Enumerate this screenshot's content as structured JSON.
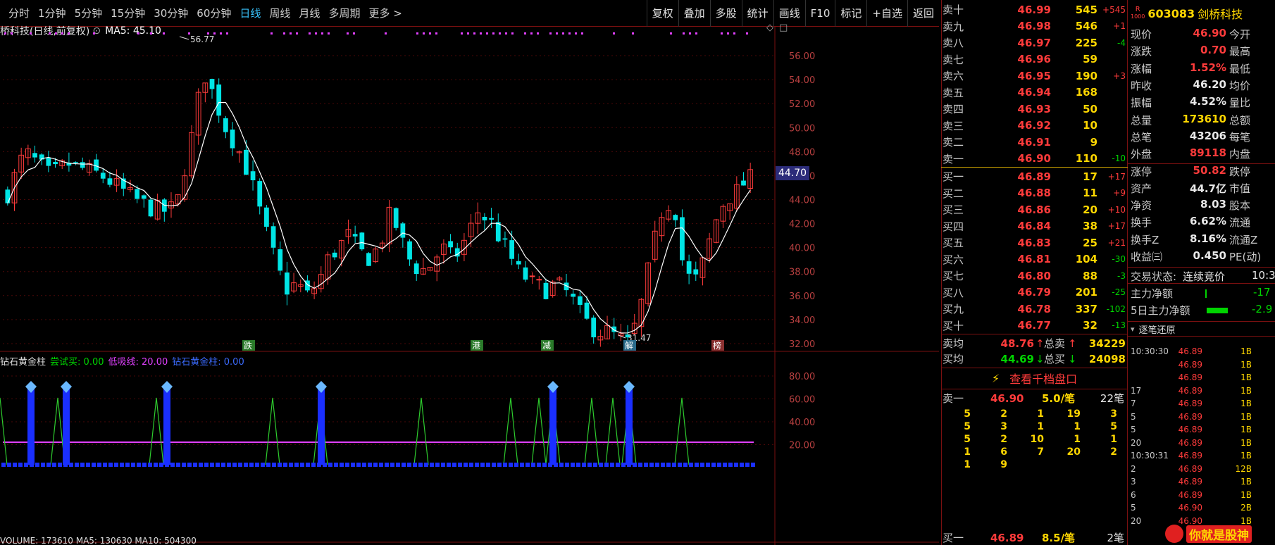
{
  "toolbar": {
    "periods": [
      "分时",
      "1分钟",
      "5分钟",
      "15分钟",
      "30分钟",
      "60分钟",
      "日线",
      "周线",
      "月线",
      "多周期",
      "更多 >"
    ],
    "active": "日线",
    "buttons": [
      "复权",
      "叠加",
      "多股",
      "统计",
      "画线",
      "F10",
      "标记",
      "+自选",
      "返回"
    ]
  },
  "chart": {
    "title": "桥科技(日线,前复权)",
    "ma_label": "MA5: 45.10",
    "high_label": "56.77",
    "low_label": "31.47",
    "price_tag": "44.70",
    "y_labels": [
      "56.00",
      "54.00",
      "52.00",
      "50.00",
      "48.00",
      "46.00",
      "44.00",
      "42.00",
      "40.00",
      "38.00",
      "36.00",
      "34.00",
      "32.00"
    ],
    "event_labels": [
      "跌",
      "港",
      "减",
      "解",
      "榜"
    ]
  },
  "indicator": {
    "name": "钻石黄金柱",
    "params": [
      {
        "label": "尝试买:",
        "value": "0.00",
        "color": "#00d400"
      },
      {
        "label": "低吸线:",
        "value": "20.00",
        "color": "#e040ff"
      },
      {
        "label": "钻石黄金柱:",
        "value": "0.00",
        "color": "#3b6bff"
      }
    ],
    "y_labels": [
      "80.00",
      "60.00",
      "40.00",
      "20.00"
    ],
    "bottom_line": "VOLUME: 173610 MA5: 130630 MA10: 504300"
  },
  "order_book": {
    "sells": [
      {
        "label": "卖十",
        "price": "46.99",
        "vol": "545",
        "chg": "+545"
      },
      {
        "label": "卖九",
        "price": "46.98",
        "vol": "546",
        "chg": "+1"
      },
      {
        "label": "卖八",
        "price": "46.97",
        "vol": "225",
        "chg": "-4"
      },
      {
        "label": "卖七",
        "price": "46.96",
        "vol": "59",
        "chg": ""
      },
      {
        "label": "卖六",
        "price": "46.95",
        "vol": "190",
        "chg": "+3"
      },
      {
        "label": "卖五",
        "price": "46.94",
        "vol": "168",
        "chg": ""
      },
      {
        "label": "卖四",
        "price": "46.93",
        "vol": "50",
        "chg": ""
      },
      {
        "label": "卖三",
        "price": "46.92",
        "vol": "10",
        "chg": ""
      },
      {
        "label": "卖二",
        "price": "46.91",
        "vol": "9",
        "chg": ""
      },
      {
        "label": "卖一",
        "price": "46.90",
        "vol": "110",
        "chg": "-10"
      }
    ],
    "buys": [
      {
        "label": "买一",
        "price": "46.89",
        "vol": "17",
        "chg": "+17"
      },
      {
        "label": "买二",
        "price": "46.88",
        "vol": "11",
        "chg": "+9"
      },
      {
        "label": "买三",
        "price": "46.86",
        "vol": "20",
        "chg": "+10"
      },
      {
        "label": "买四",
        "price": "46.84",
        "vol": "38",
        "chg": "+17"
      },
      {
        "label": "买五",
        "price": "46.83",
        "vol": "25",
        "chg": "+21"
      },
      {
        "label": "买六",
        "price": "46.81",
        "vol": "104",
        "chg": "-30"
      },
      {
        "label": "买七",
        "price": "46.80",
        "vol": "88",
        "chg": "-3"
      },
      {
        "label": "买八",
        "price": "46.79",
        "vol": "201",
        "chg": "-25"
      },
      {
        "label": "买九",
        "price": "46.78",
        "vol": "337",
        "chg": "-102"
      },
      {
        "label": "买十",
        "price": "46.77",
        "vol": "32",
        "chg": "-13"
      }
    ],
    "avg": [
      {
        "label": "卖均",
        "price": "48.76",
        "tlabel": "总卖",
        "total": "34229"
      },
      {
        "label": "买均",
        "price": "44.69",
        "tlabel": "总买",
        "total": "24098"
      }
    ],
    "view_all": "查看千档盘口",
    "queue_head": {
      "label": "卖一",
      "price": "46.90",
      "vol": "5.0/笔",
      "count": "22笔"
    },
    "queue": [
      [
        "5",
        "2",
        "1",
        "19",
        "3"
      ],
      [
        "5",
        "3",
        "1",
        "1",
        "5"
      ],
      [
        "5",
        "2",
        "10",
        "1",
        "1"
      ],
      [
        "1",
        "6",
        "7",
        "20",
        "2"
      ],
      [
        "1",
        "9",
        "",
        "",
        ""
      ]
    ],
    "bottom": {
      "label": "买一",
      "price": "46.89",
      "vol": "8.5/笔",
      "count": "2笔"
    }
  },
  "stock": {
    "code": "603083",
    "name": "剑桥科技",
    "r_badge": "R",
    "r_sub": "1000",
    "rows": [
      {
        "l": "现价",
        "v": "46.90",
        "c": "red",
        "l2": "今开"
      },
      {
        "l": "涨跌",
        "v": "0.70",
        "c": "red",
        "l2": "最高"
      },
      {
        "l": "涨幅",
        "v": "1.52%",
        "c": "red",
        "l2": "最低"
      },
      {
        "l": "昨收",
        "v": "46.20",
        "c": "white",
        "l2": "均价"
      },
      {
        "l": "振幅",
        "v": "4.52%",
        "c": "white",
        "l2": "量比"
      },
      {
        "l": "总量",
        "v": "173610",
        "c": "yellow",
        "l2": "总额"
      },
      {
        "l": "总笔",
        "v": "43206",
        "c": "white",
        "l2": "每笔"
      },
      {
        "l": "外盘",
        "v": "89118",
        "c": "red",
        "l2": "内盘"
      },
      {
        "l": "涨停",
        "v": "50.82",
        "c": "red",
        "l2": "跌停"
      },
      {
        "l": "资产",
        "v": "44.7亿",
        "c": "white",
        "l2": "市值"
      },
      {
        "l": "净资",
        "v": "8.03",
        "c": "white",
        "l2": "股本"
      },
      {
        "l": "换手",
        "v": "6.62%",
        "c": "white",
        "l2": "流通"
      },
      {
        "l": "换手Z",
        "v": "8.16%",
        "c": "white",
        "l2": "流通Z"
      },
      {
        "l": "收益㈢",
        "v": "0.450",
        "c": "white",
        "l2": "PE(动)"
      }
    ],
    "trade_state_label": "交易状态:",
    "trade_state": "连续竞价",
    "trade_time": "10:3",
    "main_net_label": "主力净额",
    "main_net": "-17",
    "five_day_label": "5日主力净额",
    "five_day": "-2.9"
  },
  "tick_panel": {
    "title": "逐笔还原",
    "rows": [
      {
        "t": "10:30:30",
        "p": "46.89",
        "pc": "red",
        "v": "1B"
      },
      {
        "t": "",
        "p": "46.89",
        "pc": "red",
        "v": "1B"
      },
      {
        "t": "",
        "p": "46.89",
        "pc": "red",
        "v": "1B"
      },
      {
        "t": "17",
        "p": "46.89",
        "pc": "red",
        "v": "1B"
      },
      {
        "t": "7",
        "p": "46.89",
        "pc": "red",
        "v": "1B"
      },
      {
        "t": "5",
        "p": "46.89",
        "pc": "red",
        "v": "1B"
      },
      {
        "t": "5",
        "p": "46.89",
        "pc": "red",
        "v": "1B"
      },
      {
        "t": "20",
        "p": "46.89",
        "pc": "red",
        "v": "1B"
      },
      {
        "t": "10:30:31",
        "p": "46.89",
        "pc": "red",
        "v": "1B"
      },
      {
        "t": "2",
        "p": "46.89",
        "pc": "red",
        "v": "12B"
      },
      {
        "t": "3",
        "p": "46.89",
        "pc": "red",
        "v": "1B"
      },
      {
        "t": "6",
        "p": "46.89",
        "pc": "red",
        "v": "1B"
      },
      {
        "t": "5",
        "p": "46.90",
        "pc": "red",
        "v": "2B"
      },
      {
        "t": "20",
        "p": "46.90",
        "pc": "red",
        "v": "1B"
      }
    ]
  },
  "watermark": "你就是股神"
}
